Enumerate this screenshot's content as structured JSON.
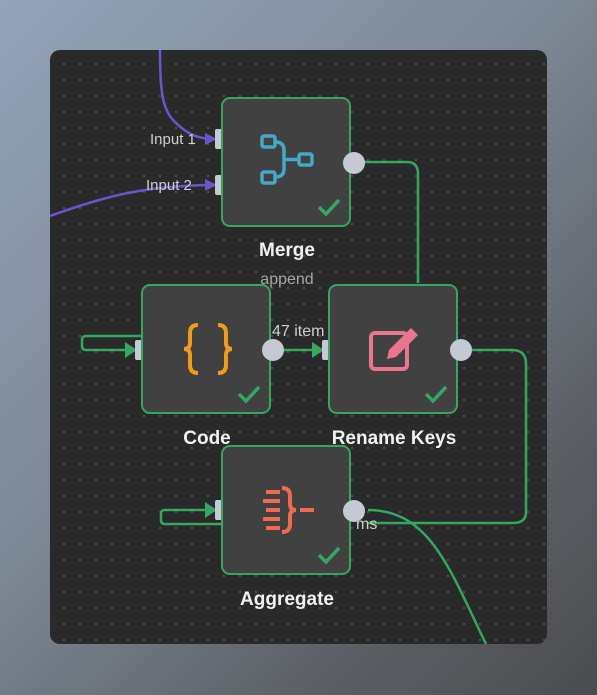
{
  "nodes": {
    "merge": {
      "name": "Merge",
      "subtitle": "append",
      "icon": "merge-branch-icon",
      "status": "success",
      "inputs": [
        "Input 1",
        "Input 2"
      ]
    },
    "code": {
      "name": "Code",
      "icon": "code-braces-icon",
      "status": "success"
    },
    "rename_keys": {
      "name": "Rename Keys",
      "icon": "edit-pen-icon",
      "status": "success"
    },
    "aggregate": {
      "name": "Aggregate",
      "icon": "aggregate-icon",
      "status": "success"
    }
  },
  "edges": {
    "code_to_rename_label": "47 item",
    "aggregate_out_label": "ms"
  },
  "colors": {
    "success_green": "#35a760",
    "input_purple": "#6b55c9",
    "merge_icon": "#45a8c4",
    "code_icon": "#f29a1c",
    "rename_icon": "#e9758f",
    "aggregate_icon": "#f06a52"
  }
}
